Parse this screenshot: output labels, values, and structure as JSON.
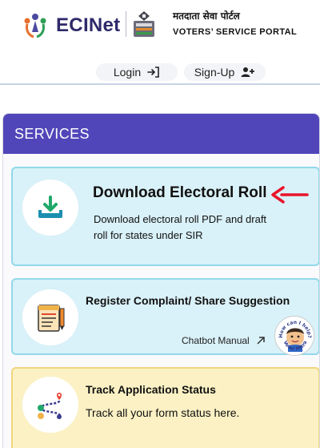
{
  "header": {
    "brand_name": "ECINet",
    "portal_title_hindi": "मतदाता सेवा पोर्टल",
    "portal_title_english": "VOTERS’ SERVICE PORTAL",
    "login_label": "Login",
    "signup_label": "Sign-Up",
    "brand_color": "#2e2a6b"
  },
  "services": {
    "heading": "SERVICES",
    "header_color": "#5146b9",
    "cards": [
      {
        "title": "Download Electoral Roll",
        "description": "Download electoral roll PDF and draft roll for states under SIR",
        "icon": "download-icon",
        "background": "#d9f1f8"
      },
      {
        "title": "Register Complaint/ Share Suggestion",
        "link_label": "Chatbot Manual",
        "icon": "complaint-document-icon",
        "background": "#d9f1f8",
        "chatbot_badge": {
          "top_text": "How can I help?",
          "bottom_text": "Voter Mitra"
        }
      },
      {
        "title": "Track Application Status",
        "description": "Track all your form status here.",
        "icon": "track-route-icon",
        "background": "#fbf1c4"
      }
    ]
  }
}
